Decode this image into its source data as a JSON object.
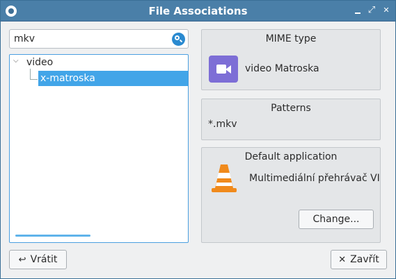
{
  "window": {
    "title": "File Associations"
  },
  "search": {
    "value": "mkv"
  },
  "tree": {
    "category": "video",
    "selected_item": "x-matroska"
  },
  "mime_panel": {
    "title": "MIME type",
    "icon": "video-file-icon",
    "label": "video Matroska"
  },
  "patterns_panel": {
    "title": "Patterns",
    "value": "*.mkv"
  },
  "default_app_panel": {
    "title": "Default application",
    "icon": "vlc-cone-icon",
    "app_name": "Multimediální přehrávač VI",
    "change_label": "Change..."
  },
  "buttons": {
    "revert_label": "Vrátit",
    "close_label": "Zavřít"
  },
  "colors": {
    "titlebar": "#4a7fa8",
    "selection": "#42a5e8",
    "mime_icon": "#7d6ed6",
    "vlc_orange": "#f08a1c"
  }
}
